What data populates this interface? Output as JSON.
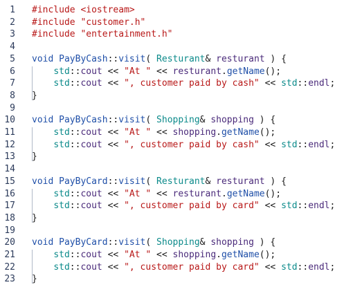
{
  "editor": {
    "lines": [
      {
        "n": "1",
        "segs": [
          [
            "pp",
            "#include "
          ],
          [
            "str",
            "<iostream>"
          ]
        ]
      },
      {
        "n": "2",
        "segs": [
          [
            "pp",
            "#include "
          ],
          [
            "str",
            "\"customer.h\""
          ]
        ]
      },
      {
        "n": "3",
        "segs": [
          [
            "pp",
            "#include "
          ],
          [
            "str",
            "\"entertainment.h\""
          ]
        ]
      },
      {
        "n": "4",
        "segs": []
      },
      {
        "n": "5",
        "segs": [
          [
            "kw",
            "void "
          ],
          [
            "fn",
            "PayByCash"
          ],
          [
            "op",
            "::"
          ],
          [
            "fn",
            "visit"
          ],
          [
            "pl",
            "( "
          ],
          [
            "ty",
            "Resturant"
          ],
          [
            "op",
            "& "
          ],
          [
            "id",
            "resturant"
          ],
          [
            "pl",
            " ) {"
          ]
        ]
      },
      {
        "n": "6",
        "segs": [
          [
            "pl",
            "    "
          ],
          [
            "ns",
            "std"
          ],
          [
            "op",
            "::"
          ],
          [
            "id",
            "cout"
          ],
          [
            "op",
            " << "
          ],
          [
            "str",
            "\"At \""
          ],
          [
            "op",
            " << "
          ],
          [
            "id",
            "resturant"
          ],
          [
            "op",
            "."
          ],
          [
            "fn",
            "getName"
          ],
          [
            "pl",
            "();"
          ]
        ]
      },
      {
        "n": "7",
        "segs": [
          [
            "pl",
            "    "
          ],
          [
            "ns",
            "std"
          ],
          [
            "op",
            "::"
          ],
          [
            "id",
            "cout"
          ],
          [
            "op",
            " << "
          ],
          [
            "str",
            "\", customer paid by cash\""
          ],
          [
            "op",
            " << "
          ],
          [
            "ns",
            "std"
          ],
          [
            "op",
            "::"
          ],
          [
            "id",
            "endl"
          ],
          [
            "pl",
            ";"
          ]
        ]
      },
      {
        "n": "8",
        "segs": [
          [
            "pl",
            "}"
          ]
        ]
      },
      {
        "n": "9",
        "segs": []
      },
      {
        "n": "10",
        "segs": [
          [
            "kw",
            "void "
          ],
          [
            "fn",
            "PayByCash"
          ],
          [
            "op",
            "::"
          ],
          [
            "fn",
            "visit"
          ],
          [
            "pl",
            "( "
          ],
          [
            "ty",
            "Shopping"
          ],
          [
            "op",
            "& "
          ],
          [
            "id",
            "shopping"
          ],
          [
            "pl",
            " ) {"
          ]
        ]
      },
      {
        "n": "11",
        "segs": [
          [
            "pl",
            "    "
          ],
          [
            "ns",
            "std"
          ],
          [
            "op",
            "::"
          ],
          [
            "id",
            "cout"
          ],
          [
            "op",
            " << "
          ],
          [
            "str",
            "\"At \""
          ],
          [
            "op",
            " << "
          ],
          [
            "id",
            "shopping"
          ],
          [
            "op",
            "."
          ],
          [
            "fn",
            "getName"
          ],
          [
            "pl",
            "();"
          ]
        ]
      },
      {
        "n": "12",
        "segs": [
          [
            "pl",
            "    "
          ],
          [
            "ns",
            "std"
          ],
          [
            "op",
            "::"
          ],
          [
            "id",
            "cout"
          ],
          [
            "op",
            " << "
          ],
          [
            "str",
            "\", customer paid by cash\""
          ],
          [
            "op",
            " << "
          ],
          [
            "ns",
            "std"
          ],
          [
            "op",
            "::"
          ],
          [
            "id",
            "endl"
          ],
          [
            "pl",
            ";"
          ]
        ]
      },
      {
        "n": "13",
        "segs": [
          [
            "pl",
            "}"
          ]
        ]
      },
      {
        "n": "14",
        "segs": []
      },
      {
        "n": "15",
        "segs": [
          [
            "kw",
            "void "
          ],
          [
            "fn",
            "PayByCard"
          ],
          [
            "op",
            "::"
          ],
          [
            "fn",
            "visit"
          ],
          [
            "pl",
            "( "
          ],
          [
            "ty",
            "Resturant"
          ],
          [
            "op",
            "& "
          ],
          [
            "id",
            "resturant"
          ],
          [
            "pl",
            " ) {"
          ]
        ]
      },
      {
        "n": "16",
        "segs": [
          [
            "pl",
            "    "
          ],
          [
            "ns",
            "std"
          ],
          [
            "op",
            "::"
          ],
          [
            "id",
            "cout"
          ],
          [
            "op",
            " << "
          ],
          [
            "str",
            "\"At \""
          ],
          [
            "op",
            " << "
          ],
          [
            "id",
            "resturant"
          ],
          [
            "op",
            "."
          ],
          [
            "fn",
            "getName"
          ],
          [
            "pl",
            "();"
          ]
        ]
      },
      {
        "n": "17",
        "segs": [
          [
            "pl",
            "    "
          ],
          [
            "ns",
            "std"
          ],
          [
            "op",
            "::"
          ],
          [
            "id",
            "cout"
          ],
          [
            "op",
            " << "
          ],
          [
            "str",
            "\", customer paid by card\""
          ],
          [
            "op",
            " << "
          ],
          [
            "ns",
            "std"
          ],
          [
            "op",
            "::"
          ],
          [
            "id",
            "endl"
          ],
          [
            "pl",
            ";"
          ]
        ]
      },
      {
        "n": "18",
        "segs": [
          [
            "pl",
            "}"
          ]
        ]
      },
      {
        "n": "19",
        "segs": []
      },
      {
        "n": "20",
        "segs": [
          [
            "kw",
            "void "
          ],
          [
            "fn",
            "PayByCard"
          ],
          [
            "op",
            "::"
          ],
          [
            "fn",
            "visit"
          ],
          [
            "pl",
            "( "
          ],
          [
            "ty",
            "Shopping"
          ],
          [
            "op",
            "& "
          ],
          [
            "id",
            "shopping"
          ],
          [
            "pl",
            " ) {"
          ]
        ]
      },
      {
        "n": "21",
        "segs": [
          [
            "pl",
            "    "
          ],
          [
            "ns",
            "std"
          ],
          [
            "op",
            "::"
          ],
          [
            "id",
            "cout"
          ],
          [
            "op",
            " << "
          ],
          [
            "str",
            "\"At \""
          ],
          [
            "op",
            " << "
          ],
          [
            "id",
            "shopping"
          ],
          [
            "op",
            "."
          ],
          [
            "fn",
            "getName"
          ],
          [
            "pl",
            "();"
          ]
        ]
      },
      {
        "n": "22",
        "segs": [
          [
            "pl",
            "    "
          ],
          [
            "ns",
            "std"
          ],
          [
            "op",
            "::"
          ],
          [
            "id",
            "cout"
          ],
          [
            "op",
            " << "
          ],
          [
            "str",
            "\", customer paid by card\""
          ],
          [
            "op",
            " << "
          ],
          [
            "ns",
            "std"
          ],
          [
            "op",
            "::"
          ],
          [
            "id",
            "endl"
          ],
          [
            "pl",
            ";"
          ]
        ]
      },
      {
        "n": "23",
        "segs": [
          [
            "pl",
            "}"
          ]
        ]
      }
    ]
  }
}
